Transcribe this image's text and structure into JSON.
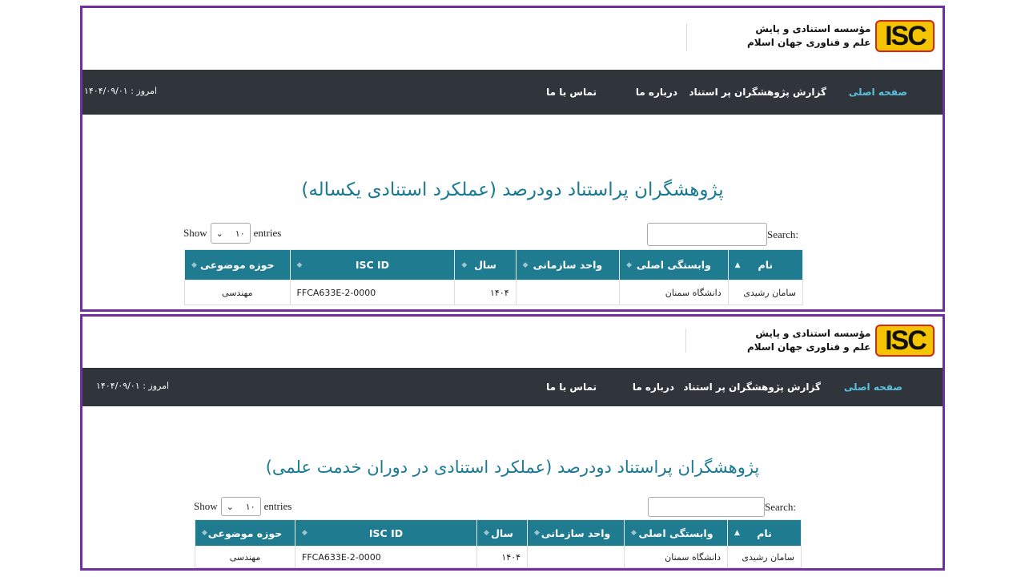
{
  "header": {
    "logo_text": "ISC",
    "org_line1": "مؤسسه استنادی و پایش",
    "org_line2": "علم و فناوری جهان اسلام"
  },
  "nav": {
    "home": "صفحه اصلی",
    "report": "گزارش پژوهشگران پر استناد",
    "about": "درباره ما",
    "contact": "تماس با ما",
    "today_label": "امروز :",
    "today_value": "۱۴۰۴/۰۹/۰۱"
  },
  "controls": {
    "show": "Show",
    "length_value": "۱۰",
    "entries": "entries",
    "search": "Search:"
  },
  "table": {
    "headers": [
      "نام",
      "وابستگی اصلی",
      "واحد سازمانی",
      "سال",
      "ISC ID",
      "حوزه موضوعی"
    ],
    "row": [
      "سامان رشیدی",
      "دانشگاه سمنان",
      "",
      "۱۴۰۴",
      "FFCA633E-2-0000",
      "مهندسی"
    ]
  },
  "panels": [
    {
      "title": "پژوهشگران پراستناد دودرصد (عملکرد استنادی یکساله)"
    },
    {
      "title": "پژوهشگران پراستناد دودرصد (عملکرد استنادی در دوران خدمت علمی)"
    }
  ],
  "colors": {
    "border": "#7030a0",
    "navbar": "#2f353a",
    "nav_active": "#5bc0de",
    "title": "#1a7a93",
    "table_header": "#1f7b90",
    "logo_bg": "#f5c400",
    "logo_border": "#d9261c"
  }
}
